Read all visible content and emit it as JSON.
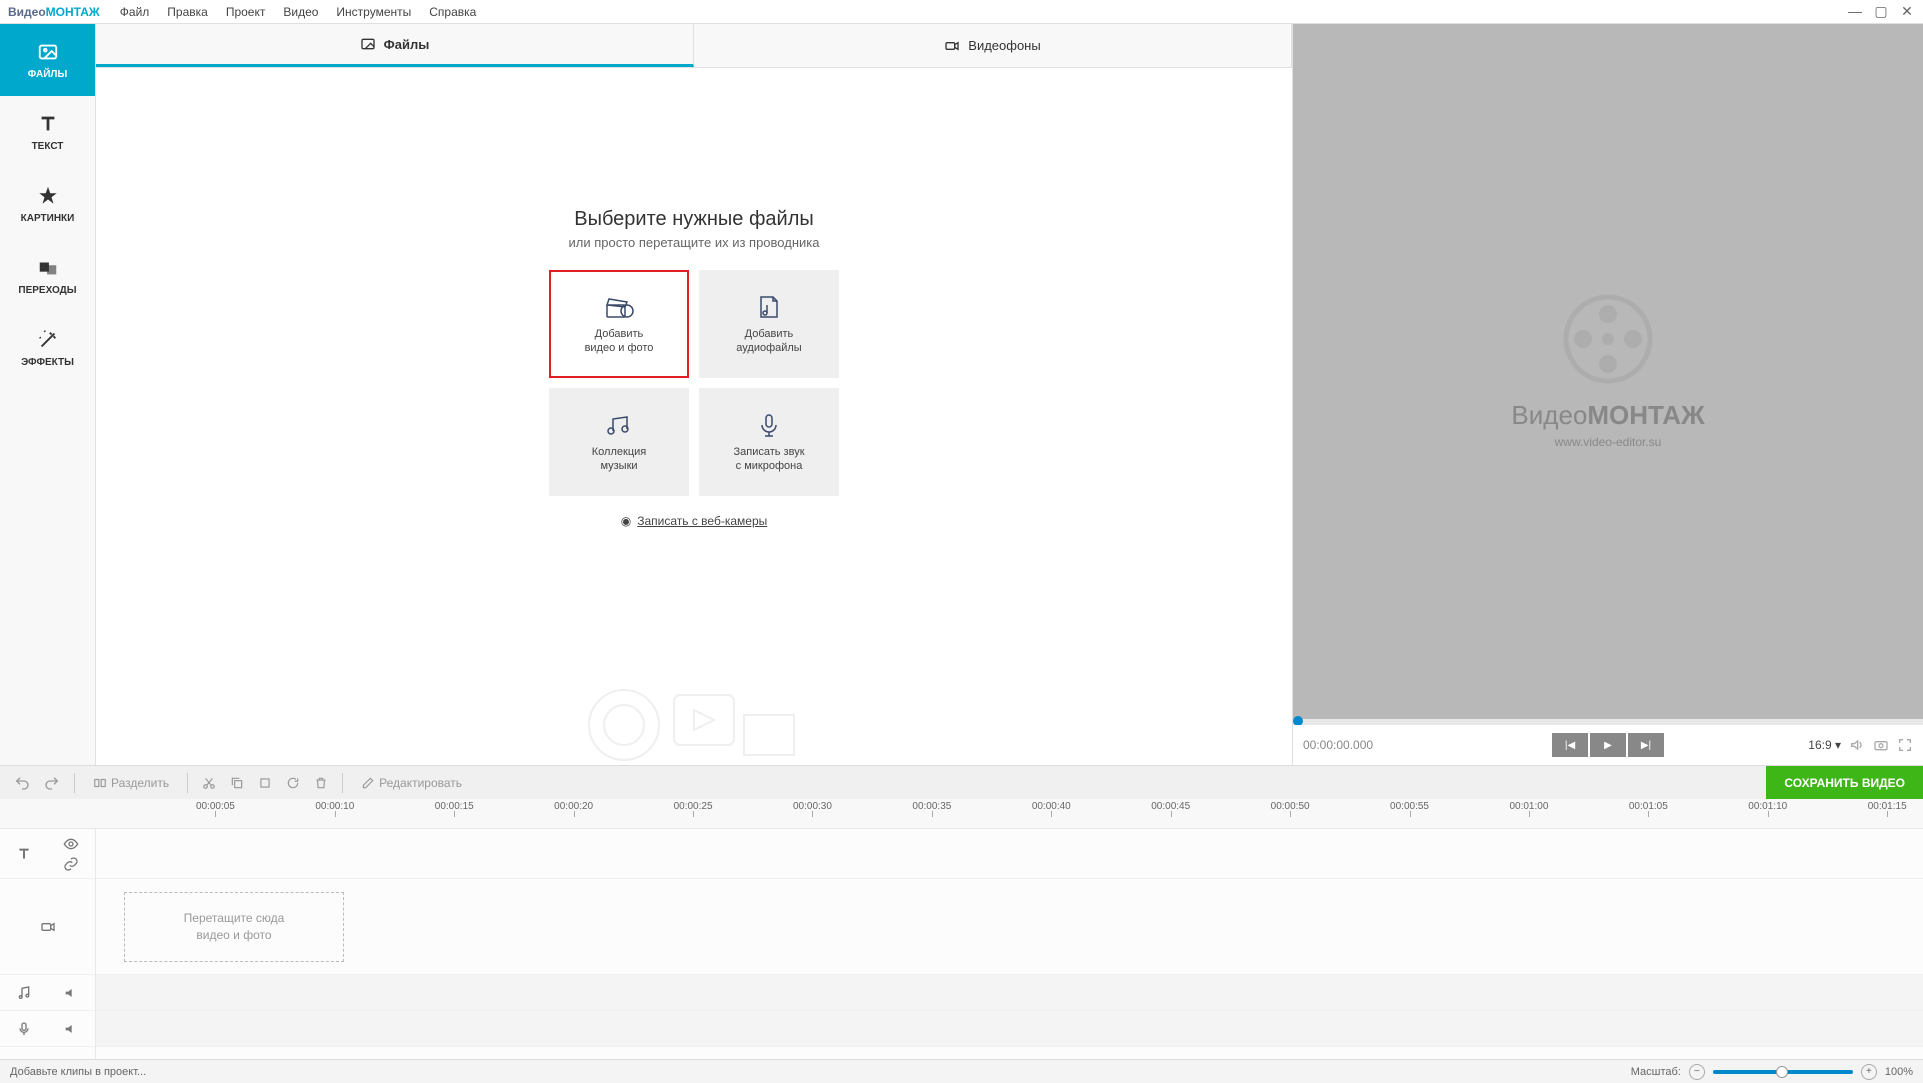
{
  "app": {
    "name_part1": "Видео",
    "name_part2": "МОНТАЖ"
  },
  "menu": [
    "Файл",
    "Правка",
    "Проект",
    "Видео",
    "Инструменты",
    "Справка"
  ],
  "sidebar": {
    "items": [
      {
        "label": "ФАЙЛЫ",
        "icon": "image"
      },
      {
        "label": "ТЕКСТ",
        "icon": "text"
      },
      {
        "label": "КАРТИНКИ",
        "icon": "star"
      },
      {
        "label": "ПЕРЕХОДЫ",
        "icon": "overlap"
      },
      {
        "label": "ЭФФЕКТЫ",
        "icon": "wand"
      }
    ]
  },
  "center_tabs": [
    {
      "label": "Файлы",
      "icon": "image-icon"
    },
    {
      "label": "Видеофоны",
      "icon": "camera-icon"
    }
  ],
  "center": {
    "heading": "Выберите нужные файлы",
    "subheading": "или просто перетащите их из проводника",
    "cards": [
      {
        "line1": "Добавить",
        "line2": "видео и фото"
      },
      {
        "line1": "Добавить",
        "line2": "аудиофайлы"
      },
      {
        "line1": "Коллекция",
        "line2": "музыки"
      },
      {
        "line1": "Записать звук",
        "line2": "с микрофона"
      }
    ],
    "webcam_link": "Записать с веб-камеры"
  },
  "preview": {
    "brand1": "Видео",
    "brand2": "МОНТАЖ",
    "url": "www.video-editor.su",
    "time": "00:00:00.000",
    "aspect": "16:9"
  },
  "toolbar": {
    "split": "Разделить",
    "edit": "Редактировать",
    "save": "СОХРАНИТЬ ВИДЕО"
  },
  "ruler_ticks": [
    "00:00:05",
    "00:00:10",
    "00:00:15",
    "00:00:20",
    "00:00:25",
    "00:00:30",
    "00:00:35",
    "00:00:40",
    "00:00:45",
    "00:00:50",
    "00:00:55",
    "00:01:00",
    "00:01:05",
    "00:01:10",
    "00:01:15"
  ],
  "dropzone": {
    "line1": "Перетащите сюда",
    "line2": "видео и фото"
  },
  "status": {
    "hint": "Добавьте клипы в проект...",
    "zoom_label": "Масштаб:",
    "zoom_value": "100%"
  }
}
